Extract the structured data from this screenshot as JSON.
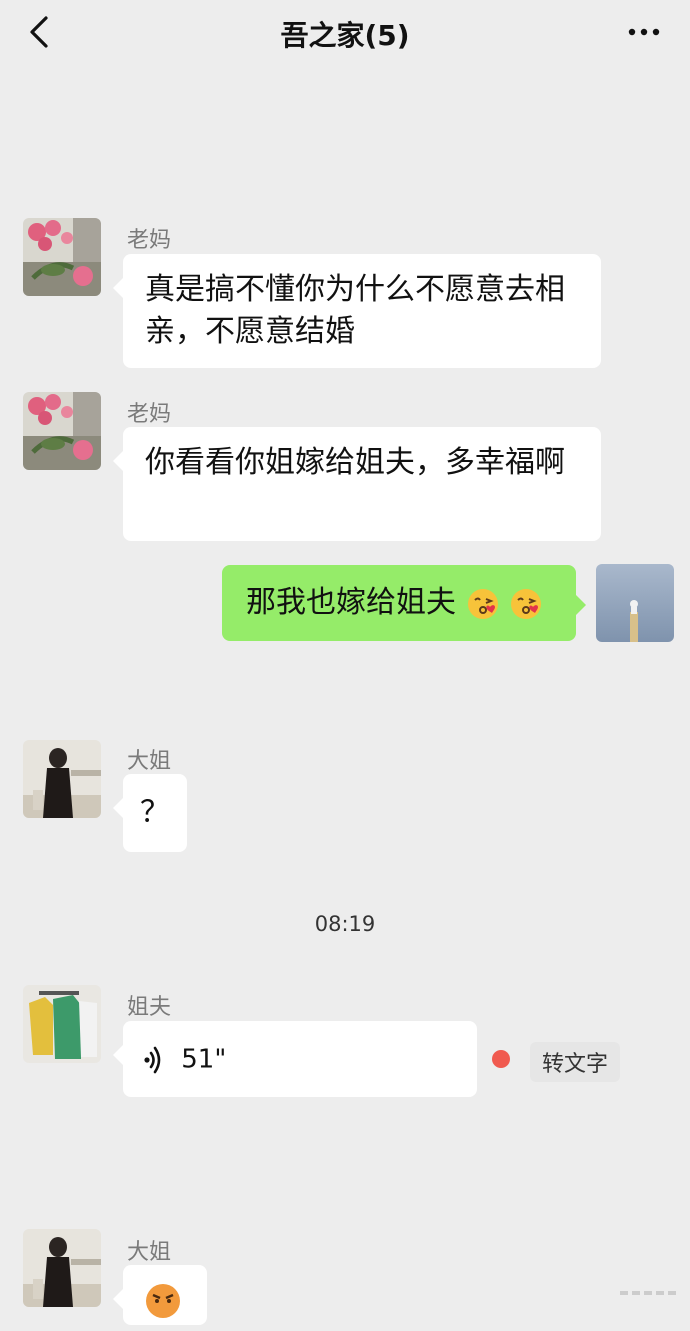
{
  "header": {
    "title": "吾之家(5)"
  },
  "messages": [
    {
      "sender": "老妈",
      "text": "真是搞不懂你为什么不愿意去相亲，不愿意结婚"
    },
    {
      "sender": "老妈",
      "text": "你看看你姐嫁给姐夫，多幸福啊"
    },
    {
      "sender": "me",
      "text": "那我也嫁给姐夫",
      "emoji": [
        "kissing-face-emoji",
        "kissing-face-emoji"
      ]
    },
    {
      "sender": "大姐",
      "text": "？"
    },
    {
      "timestamp": "08:19"
    },
    {
      "sender": "姐夫",
      "voice_duration": "51\"",
      "to_text_label": "转文字",
      "unread_color": "#f05a4f"
    },
    {
      "sender": "大姐",
      "emoji": [
        "angry-face-emoji"
      ]
    }
  ],
  "colors": {
    "background": "#ededed",
    "my_bubble": "#95ec69",
    "their_bubble": "#ffffff"
  }
}
